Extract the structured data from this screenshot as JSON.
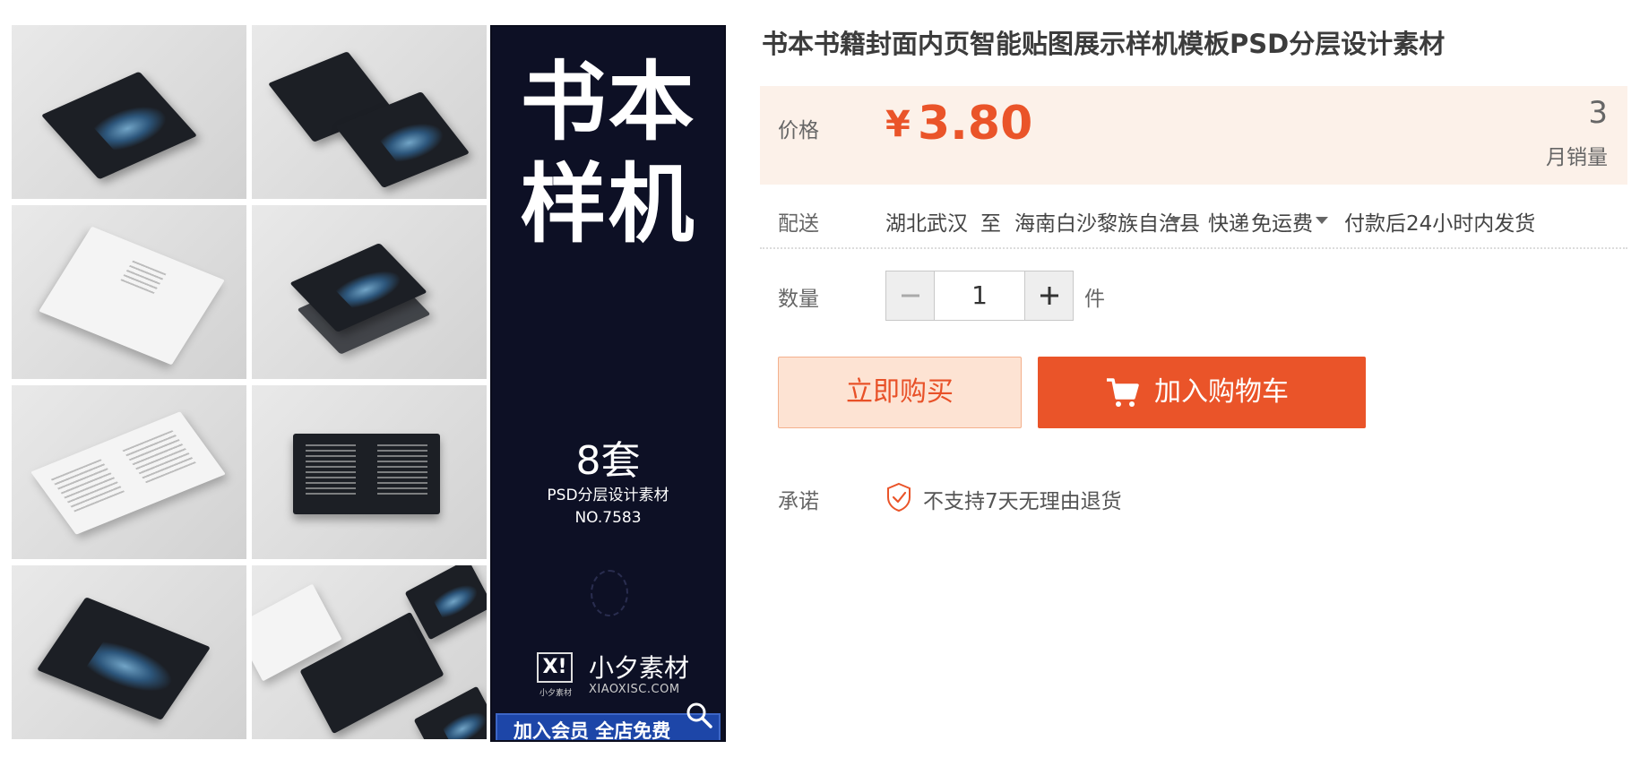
{
  "product": {
    "title": "书本书籍封面内页智能贴图展示样机模板PSD分层设计素材"
  },
  "gallery": {
    "poster": {
      "title_line1": "书本",
      "title_line2": "样机",
      "count": "8套",
      "subtitle": "PSD分层设计素材",
      "number": "NO.7583",
      "logo_mark": "X!",
      "logo_caption": "小夕素材",
      "brand": "小夕素材",
      "url": "XIAOXISC.COM",
      "banner": "加入会员 全店免费"
    }
  },
  "price": {
    "label": "价格",
    "currency": "¥",
    "value": "3.80",
    "monthly_sales_count": "3",
    "monthly_sales_label": "月销量"
  },
  "shipping": {
    "label": "配送",
    "origin": "湖北武汉",
    "to": "至",
    "destination": "海南白沙黎族自治县",
    "method": "快递",
    "fee": "免运费",
    "dispatch": "付款后24小时内发货"
  },
  "quantity": {
    "label": "数量",
    "value": "1",
    "unit": "件"
  },
  "actions": {
    "buy_now": "立即购买",
    "add_to_cart": "加入购物车"
  },
  "promise": {
    "label": "承诺",
    "text": "不支持7天无理由退货"
  },
  "colors": {
    "accent": "#ea5429",
    "price_bg": "#fcf1e9",
    "poster_bg": "#0d1025",
    "banner": "#1d46a8"
  }
}
